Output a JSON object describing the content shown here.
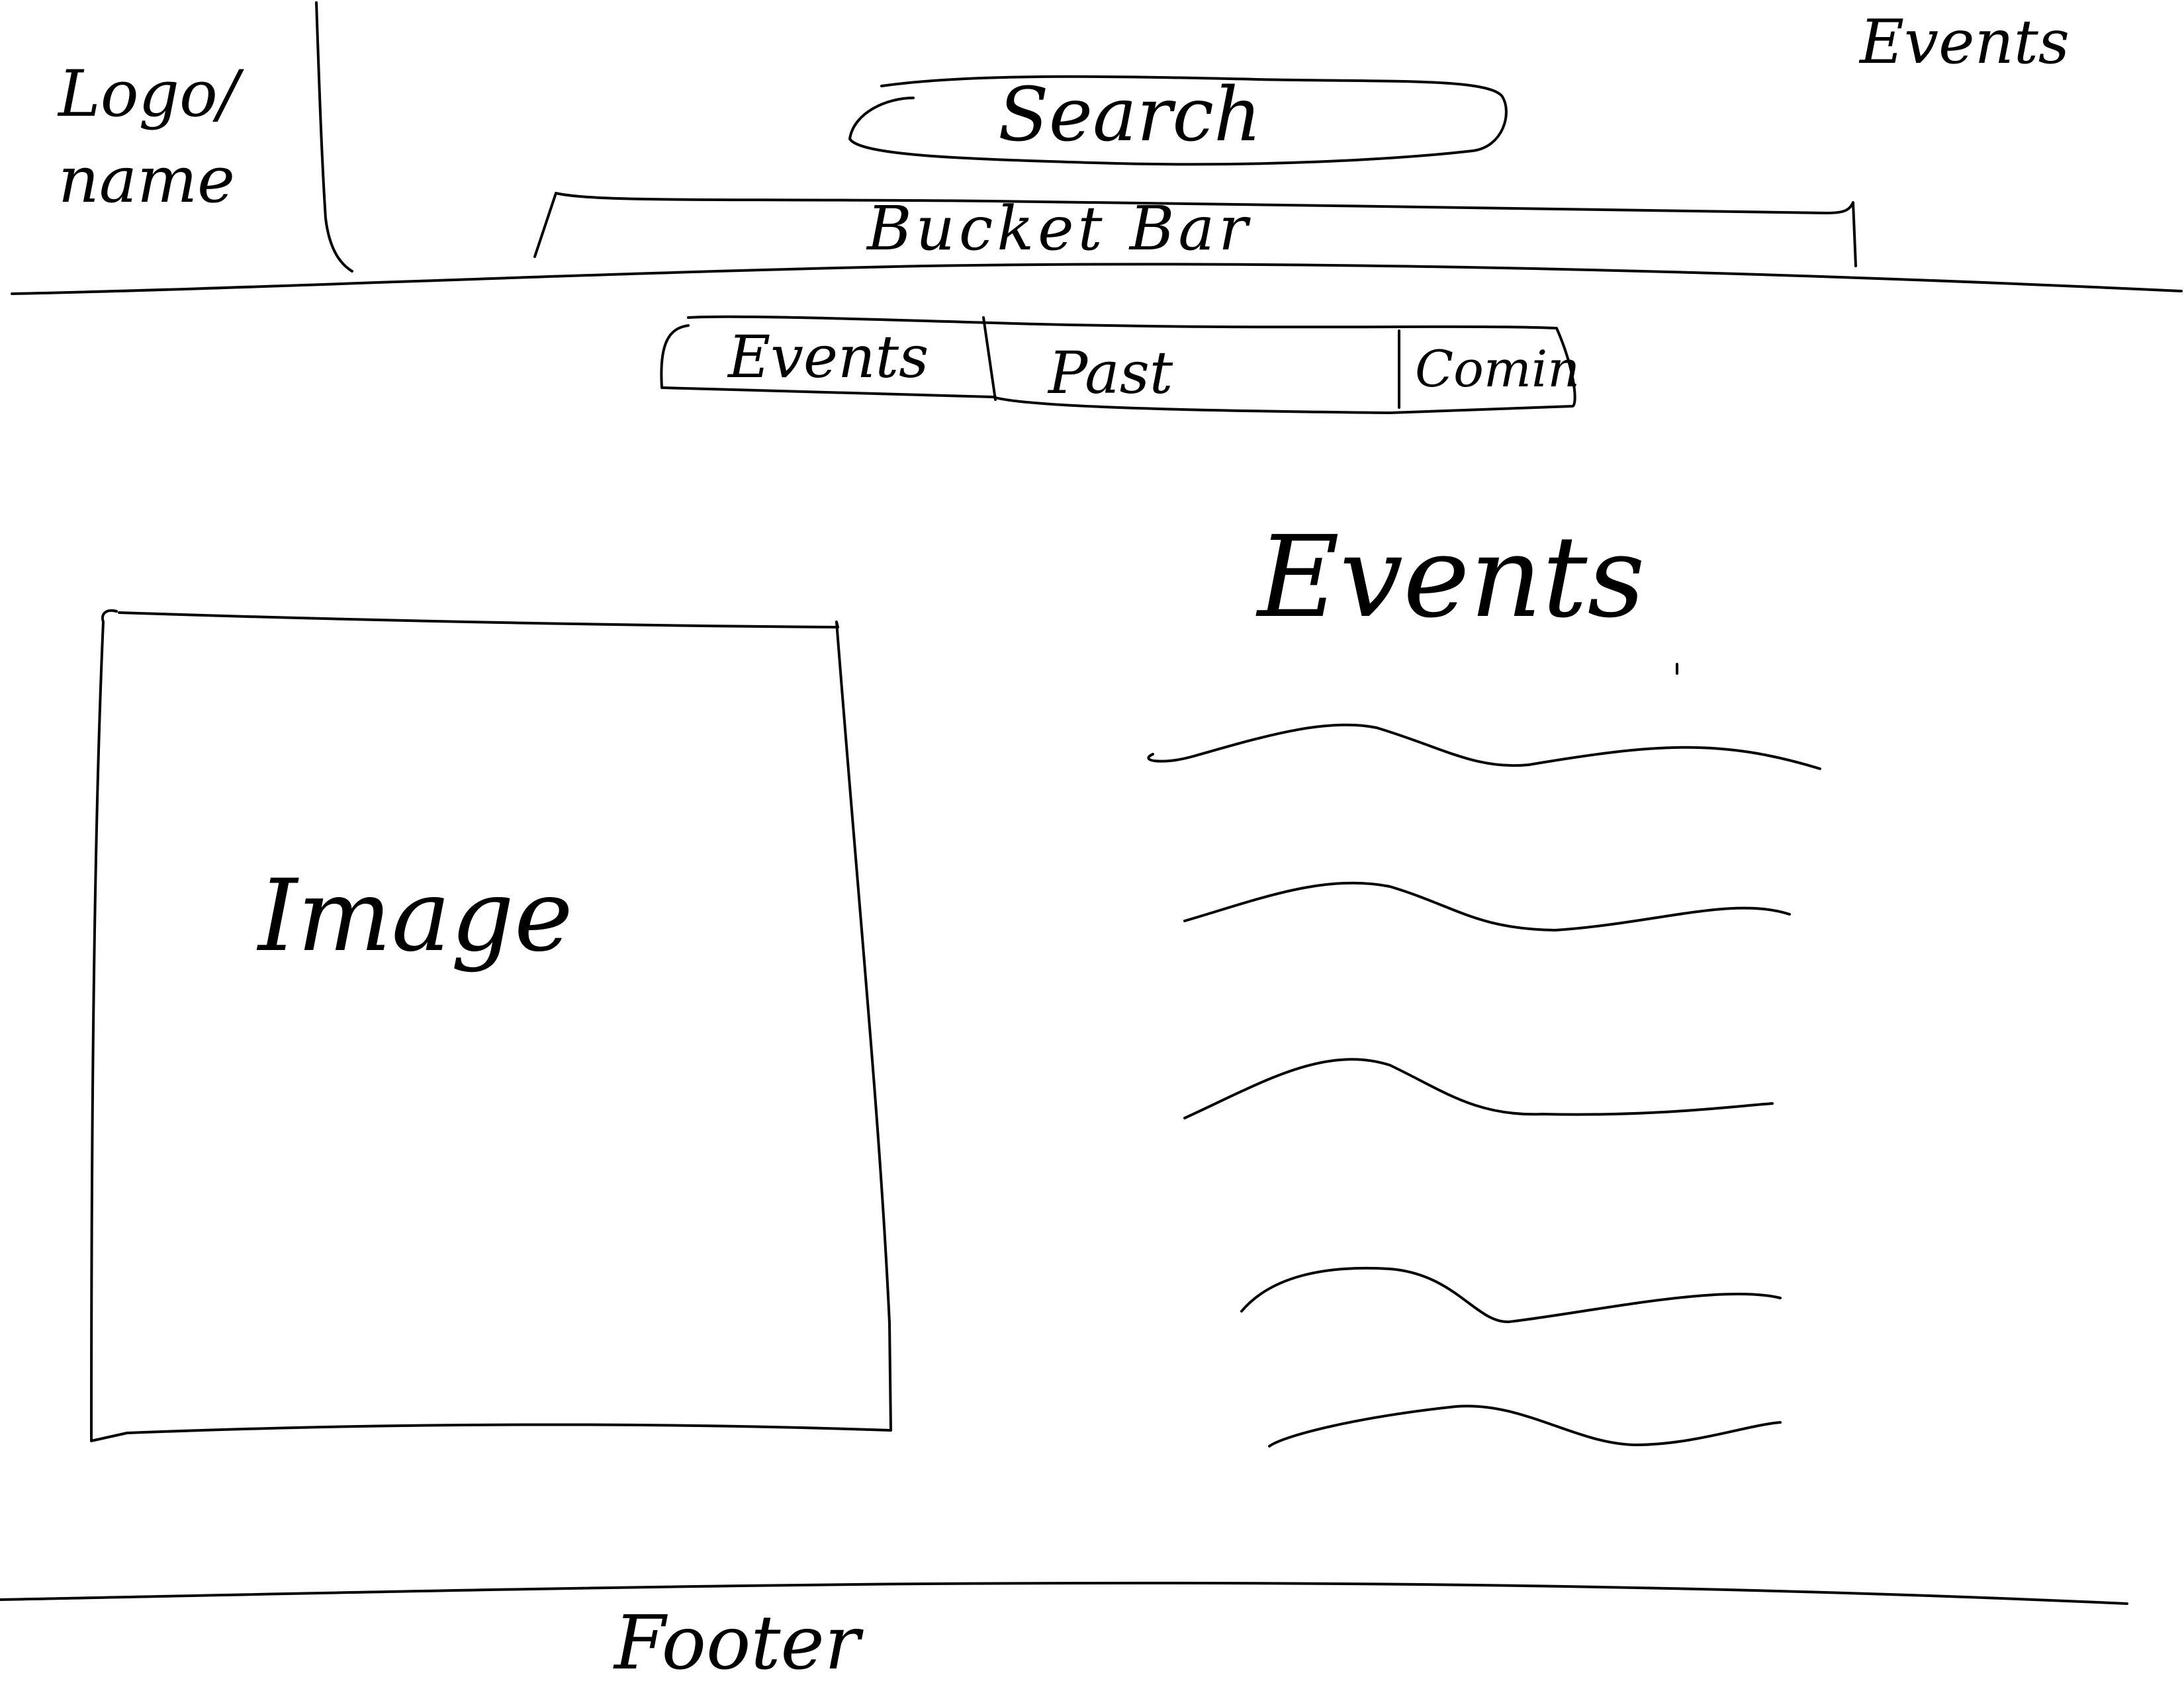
{
  "header": {
    "logo_text": "Logo/ name",
    "search_label": "Search",
    "bucket_bar_label": "Bucket Bar",
    "nav_link_events": "Events"
  },
  "events_tabs": {
    "tabs": [
      {
        "label": "Events"
      },
      {
        "label": "Past"
      },
      {
        "label": "Comin"
      }
    ]
  },
  "main": {
    "image_label": "Image",
    "events_heading": "Events",
    "event_item_count": 5
  },
  "footer": {
    "label": "Footer"
  }
}
